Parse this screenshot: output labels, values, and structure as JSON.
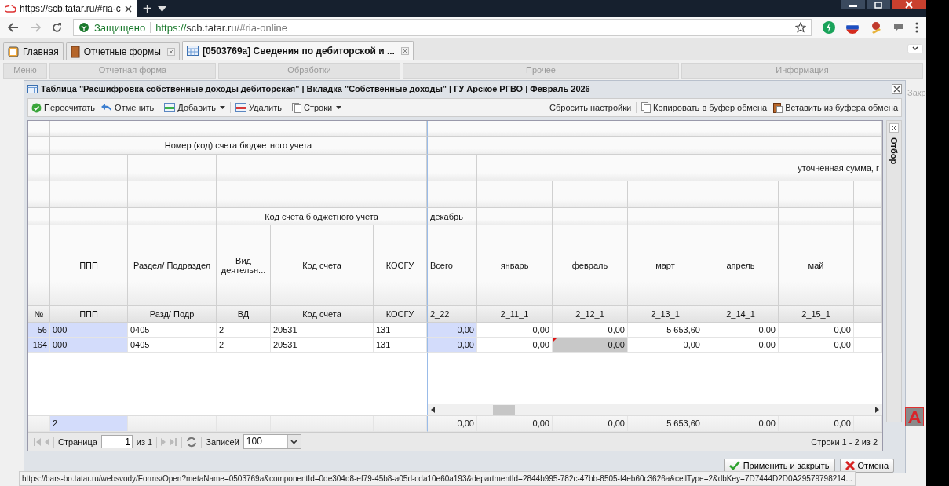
{
  "browser": {
    "tab_title": "https://scb.tatar.ru/#ria-c",
    "new_tab": "+",
    "security": "Защищено",
    "url_scheme": "https://",
    "url_host": "scb.tatar.ru",
    "url_rest": "/#ria-online",
    "status_url": "https://bars-bo.tatar.ru/websvody/Forms/Open?metaName=0503769a&componentId=0de304d8-ef79-45b8-a05d-cda10e60a193&departmentId=2844b995-782c-47bb-8505-f4eb60c3626a&cellType=2&dbKey=7D7444D2D0A29579798214..."
  },
  "app_tabs": [
    {
      "label": "Главная",
      "selected": false,
      "closable": false,
      "kind": "home"
    },
    {
      "label": "Отчетные формы",
      "selected": false,
      "closable": true,
      "kind": "book"
    },
    {
      "label": "[0503769a] Сведения по дебиторской и ...",
      "selected": true,
      "closable": true,
      "kind": "table"
    }
  ],
  "ribbon_groups": [
    "Меню",
    "Отчетная форма",
    "Обработки",
    "Прочее",
    "Информация"
  ],
  "side_text": "Закр",
  "dialog": {
    "title": "Таблица \"Расшифровка собственные доходы дебиторская\" | Вкладка \"Собственные доходы\" | ГУ Арское РГВО | Февраль 2026",
    "toolbar_left": [
      {
        "label": "Пересчитать",
        "kind": "recalc",
        "menu": false
      },
      {
        "label": "Отменить",
        "kind": "undo",
        "menu": false
      },
      {
        "label": "Добавить",
        "kind": "add",
        "menu": true
      },
      {
        "label": "Удалить",
        "kind": "delete",
        "menu": false
      },
      {
        "label": "Строки",
        "kind": "rows",
        "menu": true
      }
    ],
    "toolbar_right": [
      {
        "label": "Сбросить настройки",
        "kind": "plain"
      },
      {
        "label": "Копировать в буфер обмена",
        "kind": "copy"
      },
      {
        "label": "Вставить из буфера обмена",
        "kind": "paste"
      }
    ],
    "filter_panel": "Отбор",
    "grid": {
      "top_group": "Номер (код) счета бюджетного учета",
      "sub_group": "Код счета бюджетного учета",
      "month_group": "декабрь",
      "right_group": "уточненная сумма, г",
      "number_header": "№",
      "columns": [
        {
          "title": "ППП",
          "code": "ППП",
          "kind": "text",
          "highlighted": true
        },
        {
          "title": "Раздел/ Подраздел",
          "code": "Разд/ Подр",
          "kind": "text",
          "highlighted": false
        },
        {
          "title": "Вид деятельн...",
          "code": "ВД",
          "kind": "text",
          "highlighted": false
        },
        {
          "title": "Код счета",
          "code": "Код счета",
          "kind": "text",
          "highlighted": false
        },
        {
          "title": "КОСГУ",
          "code": "КОСГУ",
          "kind": "text",
          "highlighted": false
        },
        {
          "title": "Всего",
          "code": "2_22",
          "kind": "number",
          "highlighted": true
        },
        {
          "title": "январь",
          "code": "2_11_1",
          "kind": "number",
          "highlighted": false
        },
        {
          "title": "февраль",
          "code": "2_12_1",
          "kind": "number",
          "highlighted": false
        },
        {
          "title": "март",
          "code": "2_13_1",
          "kind": "number",
          "highlighted": false
        },
        {
          "title": "апрель",
          "code": "2_14_1",
          "kind": "number",
          "highlighted": false
        },
        {
          "title": "май",
          "code": "2_15_1",
          "kind": "number",
          "highlighted": false
        }
      ],
      "rows": [
        {
          "number": "56",
          "cells": [
            {
              "value": "000",
              "modified": false
            },
            {
              "value": "0405",
              "modified": false
            },
            {
              "value": "2",
              "modified": false
            },
            {
              "value": "20531",
              "modified": false
            },
            {
              "value": "131",
              "modified": false
            },
            {
              "value": "0,00",
              "modified": false
            },
            {
              "value": "0,00",
              "modified": false
            },
            {
              "value": "0,00",
              "modified": false
            },
            {
              "value": "5 653,60",
              "modified": false
            },
            {
              "value": "0,00",
              "modified": false
            },
            {
              "value": "0,00",
              "modified": false
            }
          ]
        },
        {
          "number": "164",
          "cells": [
            {
              "value": "000",
              "modified": false
            },
            {
              "value": "0405",
              "modified": false
            },
            {
              "value": "2",
              "modified": false
            },
            {
              "value": "20531",
              "modified": false
            },
            {
              "value": "131",
              "modified": false
            },
            {
              "value": "0,00",
              "modified": false
            },
            {
              "value": "0,00",
              "modified": false
            },
            {
              "value": "0,00",
              "modified": true
            },
            {
              "value": "0,00",
              "modified": false
            },
            {
              "value": "0,00",
              "modified": false
            },
            {
              "value": "0,00",
              "modified": false
            }
          ]
        }
      ],
      "summary": {
        "count": "2",
        "totals": [
          "0,00",
          "0,00",
          "0,00",
          "5 653,60",
          "0,00",
          "0,00"
        ]
      }
    },
    "pager": {
      "page_label": "Страница",
      "page": "1",
      "page_total": "из 1",
      "records_label": "Записей",
      "records": "100",
      "info": "Строки 1 - 2 из 2"
    },
    "buttons": [
      {
        "label": "Применить и закрыть",
        "kind": "apply"
      },
      {
        "label": "Отмена",
        "kind": "cancel"
      }
    ]
  }
}
